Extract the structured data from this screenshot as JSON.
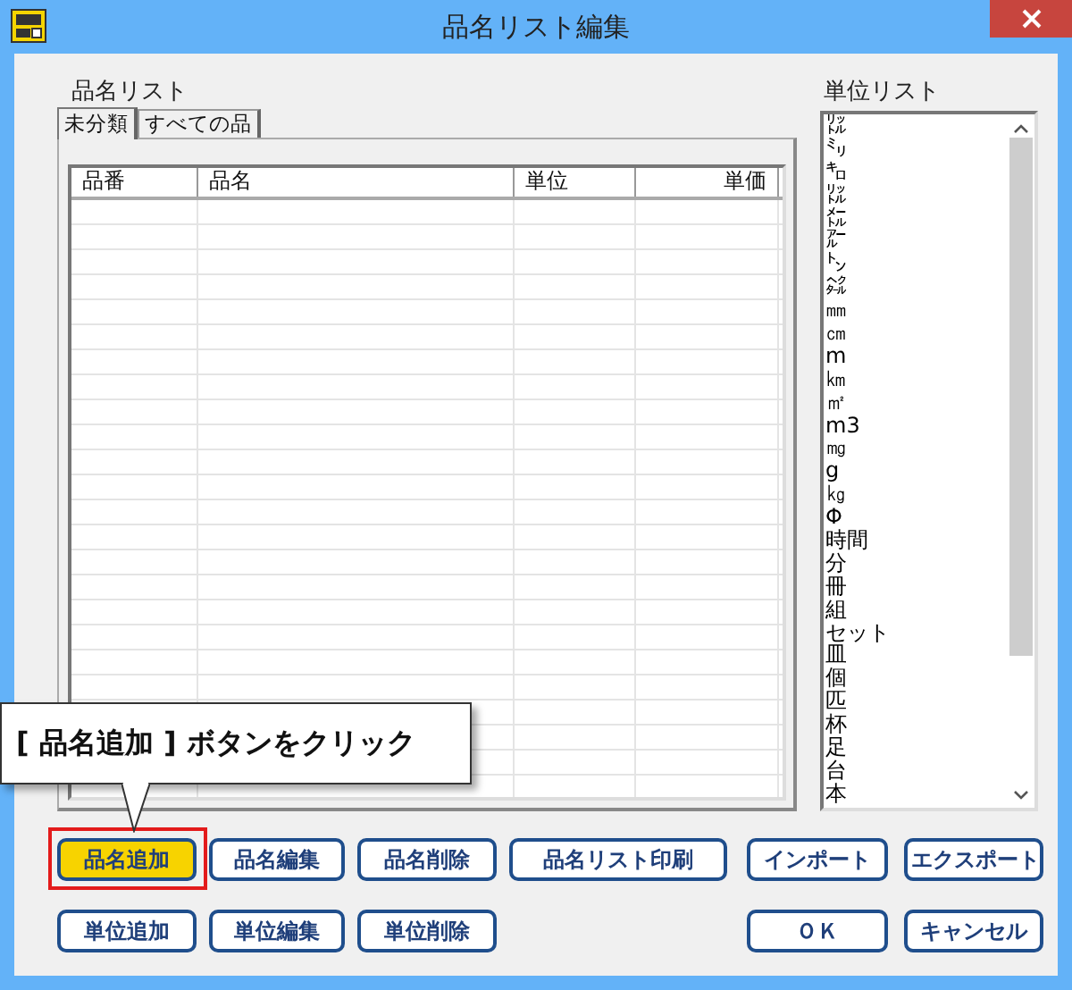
{
  "window": {
    "title": "品名リスト編集"
  },
  "item_list": {
    "label": "品名リスト",
    "tabs": [
      {
        "label": "未分類",
        "selected": true
      },
      {
        "label": "すべての品",
        "selected": false
      }
    ],
    "columns": [
      "品番",
      "品名",
      "単位",
      "単価"
    ]
  },
  "unit_list": {
    "label": "単位リスト",
    "items": [
      "㍑",
      "㍉",
      "㌔",
      "㍑",
      "㍍",
      "㌃",
      "㌧",
      "㌶",
      "㎜",
      "㎝",
      "m",
      "㎞",
      "㎡",
      "m3",
      "㎎",
      "g",
      "㎏",
      "Φ",
      "時間",
      "分",
      "冊",
      "組",
      "セット",
      "皿",
      "個",
      "匹",
      "杯",
      "足",
      "台",
      "本"
    ]
  },
  "button_rows": [
    {
      "left": [
        {
          "label": "品名追加",
          "highlighted": true
        },
        {
          "label": "品名編集",
          "highlighted": false
        },
        {
          "label": "品名削除",
          "highlighted": false
        },
        {
          "label": "品名リスト印刷",
          "highlighted": false
        }
      ],
      "right": [
        {
          "label": "インポート",
          "highlighted": false
        },
        {
          "label": "エクスポート",
          "highlighted": false
        }
      ]
    },
    {
      "left": [
        {
          "label": "単位追加",
          "highlighted": false
        },
        {
          "label": "単位編集",
          "highlighted": false
        },
        {
          "label": "単位削除",
          "highlighted": false
        }
      ],
      "right": [
        {
          "label": "ＯＫ",
          "highlighted": false
        },
        {
          "label": "キャンセル",
          "highlighted": false
        }
      ]
    }
  ],
  "callout": {
    "text": "[ 品名追加 ] ボタンをクリック"
  }
}
